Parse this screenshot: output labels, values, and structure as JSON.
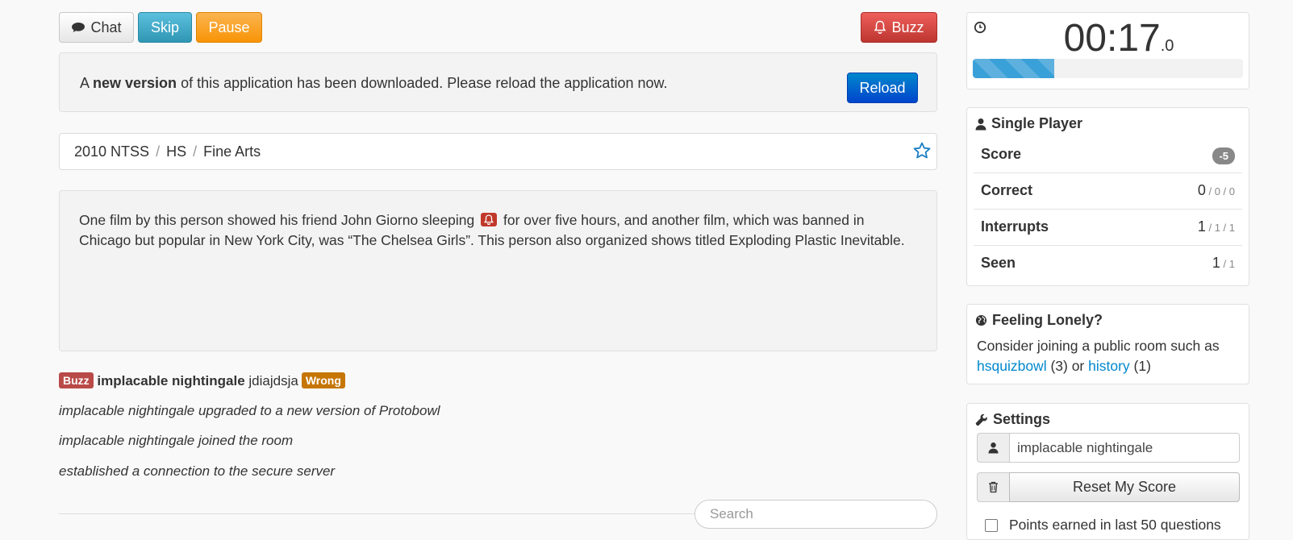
{
  "toolbar": {
    "chat_label": "Chat",
    "skip_label": "Skip",
    "pause_label": "Pause",
    "buzz_label": "Buzz"
  },
  "alert": {
    "prefix": "A ",
    "bold": "new version",
    "suffix": " of this application has been downloaded. Please reload the application now.",
    "reload_label": "Reload"
  },
  "breadcrumb": {
    "items": [
      "2010 NTSS",
      "HS",
      "Fine Arts"
    ],
    "separator": "/"
  },
  "question": {
    "part1": "One film by this person showed his friend John Giorno sleeping",
    "part2": "for over five hours, and another film, which was banned in Chicago but popular in New York City, was “The Chelsea Girls”. This person also organized shows titled Exploding Plastic Inevitable."
  },
  "log": {
    "buzz_badge": "Buzz",
    "buzz_user": "implacable nightingale",
    "buzz_answer": "jdiajdsja",
    "wrong_badge": "Wrong",
    "line2": "implacable nightingale upgraded to a new version of Protobowl",
    "line3": "implacable nightingale joined the room",
    "line4": "established a connection to the secure server"
  },
  "search": {
    "placeholder": "Search"
  },
  "timer": {
    "main": "00:17",
    "fraction": ".0",
    "progress_percent": 30
  },
  "single_player": {
    "title": "Single Player",
    "score_label": "Score",
    "score_value": "-5",
    "correct_label": "Correct",
    "correct_value": "0",
    "correct_extra": " / 0 / 0",
    "interrupts_label": "Interrupts",
    "interrupts_value": "1",
    "interrupts_extra": " / 1 / 1",
    "seen_label": "Seen",
    "seen_value": "1",
    "seen_extra": " / 1"
  },
  "lonely": {
    "title": "Feeling Lonely?",
    "text": "Consider joining a public room such as",
    "room1": "hsquizbowl",
    "room1_count": " (3) or ",
    "room2": "history",
    "room2_count": " (1)"
  },
  "settings": {
    "title": "Settings",
    "name_value": "implacable nightingale",
    "reset_label": "Reset My Score",
    "points_label": "Points earned in last 50 questions"
  },
  "colors": {
    "accent_blue": "#0088cc",
    "danger": "#bd362f",
    "warning": "#f89406",
    "info": "#2f96b4"
  }
}
